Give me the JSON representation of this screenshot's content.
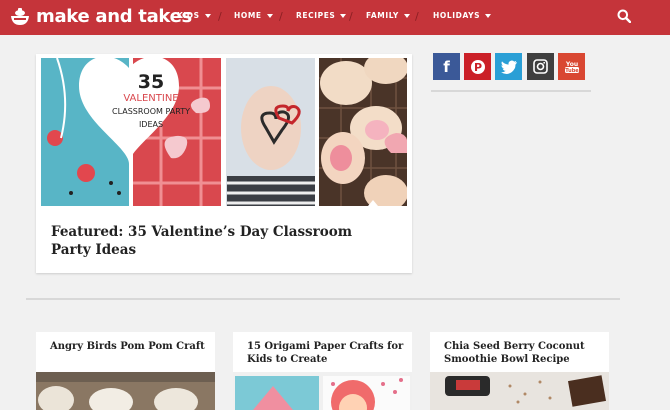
{
  "header": {
    "logo_text": "make and takes",
    "brand_color": "#c5343a",
    "nav": [
      {
        "label": "KIDS"
      },
      {
        "label": "HOME"
      },
      {
        "label": "RECIPES"
      },
      {
        "label": "FAMILY"
      },
      {
        "label": "HOLIDAYS"
      }
    ],
    "search_icon": "search-icon"
  },
  "featured": {
    "title": "Featured: 35 Valentine’s Day Classroom Party Ideas",
    "image_heart_number": "35",
    "image_heart_line1": "VALENTINE",
    "image_heart_line2": "CLASSROOM PARTY",
    "image_heart_line3": "IDEAS"
  },
  "social": [
    {
      "icon": "facebook-icon",
      "glyph": "f",
      "color": "#3b5998"
    },
    {
      "icon": "pinterest-icon",
      "glyph": "P",
      "color": "#cb2027"
    },
    {
      "icon": "twitter-icon",
      "glyph": "t",
      "color": "#2a9fd6"
    },
    {
      "icon": "instagram-icon",
      "glyph": "◘",
      "color": "#3f3f3f"
    },
    {
      "icon": "youtube-icon",
      "glyph": "You",
      "color": "#d94732"
    }
  ],
  "posts": [
    {
      "title": "Angry Birds Pom Pom Craft"
    },
    {
      "title": "15 Origami Paper Crafts for Kids to Create"
    },
    {
      "title": "Chia Seed Berry Coconut Smoothie Bowl Recipe"
    }
  ]
}
